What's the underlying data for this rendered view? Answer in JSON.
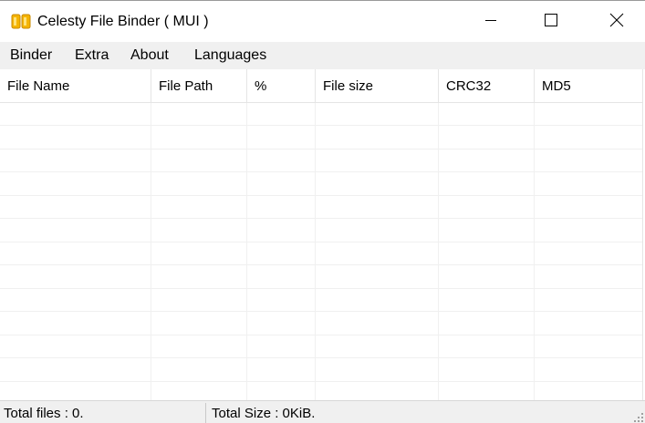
{
  "window": {
    "title": "Celesty File Binder ( MUI )",
    "icon": "binder-app-icon",
    "accent_color": "#f2a900"
  },
  "menubar": {
    "items": [
      "Binder",
      "Extra",
      "About",
      "Languages"
    ]
  },
  "table": {
    "columns": [
      "File Name",
      "File Path",
      "%",
      "File size",
      "CRC32",
      "MD5"
    ],
    "rows": []
  },
  "statusbar": {
    "total_files": "Total files : 0.",
    "total_size": "Total Size : 0KiB."
  }
}
